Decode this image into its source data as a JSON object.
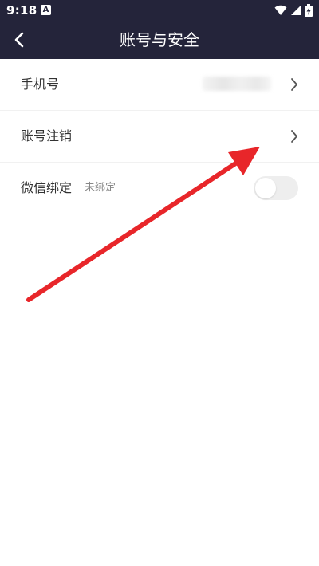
{
  "status_bar": {
    "time": "9:18",
    "notification_glyph": "A",
    "icons": [
      "wifi-icon",
      "signal-icon",
      "battery-charging-icon"
    ]
  },
  "header": {
    "title": "账号与安全",
    "back_icon": "chevron-left-icon"
  },
  "rows": [
    {
      "label": "手机号",
      "value_state": "blurred",
      "trailing": "chevron-right-icon"
    },
    {
      "label": "账号注销",
      "trailing": "chevron-right-icon"
    },
    {
      "label": "微信绑定",
      "status": "未绑定",
      "toggle_on": false
    }
  ],
  "colors": {
    "header_bg": "#24243a",
    "annotation_arrow": "#e8262a"
  }
}
